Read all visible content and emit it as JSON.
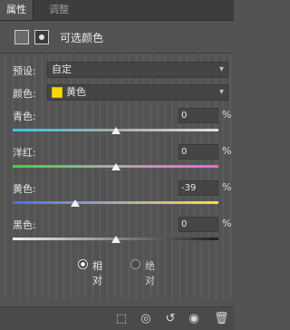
{
  "tabs": [
    {
      "label": "属性"
    },
    {
      "label": "调整"
    }
  ],
  "header": {
    "title": "可选颜色"
  },
  "preset": {
    "label": "预设:",
    "value": "自定"
  },
  "color": {
    "label": "颜色:",
    "value": "黄色",
    "swatch": "#f7d900"
  },
  "sliders": [
    {
      "label": "青色:",
      "value": "0",
      "unit": "%",
      "level": 0
    },
    {
      "label": "洋红:",
      "value": "0",
      "unit": "%",
      "level": 0
    },
    {
      "label": "黄色:",
      "value": "-39",
      "unit": "%",
      "level": -39
    },
    {
      "label": "黑色:",
      "value": "0",
      "unit": "%",
      "level": 0
    }
  ],
  "method": {
    "relative": "相对",
    "absolute": "绝对",
    "selected": "relative"
  },
  "footer_icons": [
    "clip-to-layer-icon",
    "view-previous-icon",
    "reset-icon",
    "visibility-eye-icon",
    "trash-icon"
  ]
}
